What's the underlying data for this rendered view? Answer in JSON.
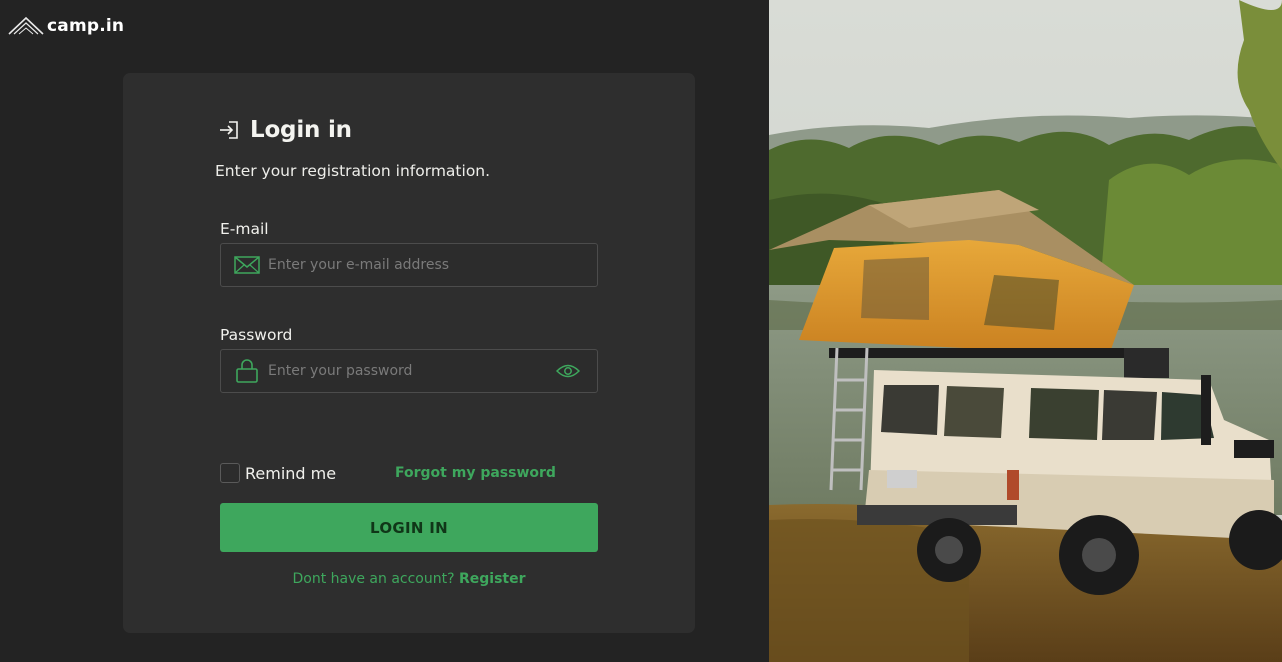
{
  "brand": {
    "name": "camp.in",
    "logo_icon": "tent-logo-icon"
  },
  "login": {
    "title": "Login in",
    "title_icon": "login-arrow-icon",
    "subtitle": "Enter your registration information.",
    "email": {
      "label": "E-mail",
      "placeholder": "Enter your e-mail address",
      "value": "",
      "icon": "mail-icon"
    },
    "password": {
      "label": "Password",
      "placeholder": "Enter your password",
      "value": "",
      "icon": "lock-icon",
      "toggle_icon": "eye-icon"
    },
    "remember_label": "Remind me",
    "remember_checked": false,
    "forgot_label": "Forgot my password",
    "submit_label": "LOGIN IN",
    "register_prompt": "Dont have an account?",
    "register_label": "Register"
  },
  "colors": {
    "accent": "#3ea75d",
    "background": "#232323",
    "card": "#2e2e2e"
  },
  "hero_image": {
    "subject": "rooftop-tent-suv-by-lake-photo"
  }
}
